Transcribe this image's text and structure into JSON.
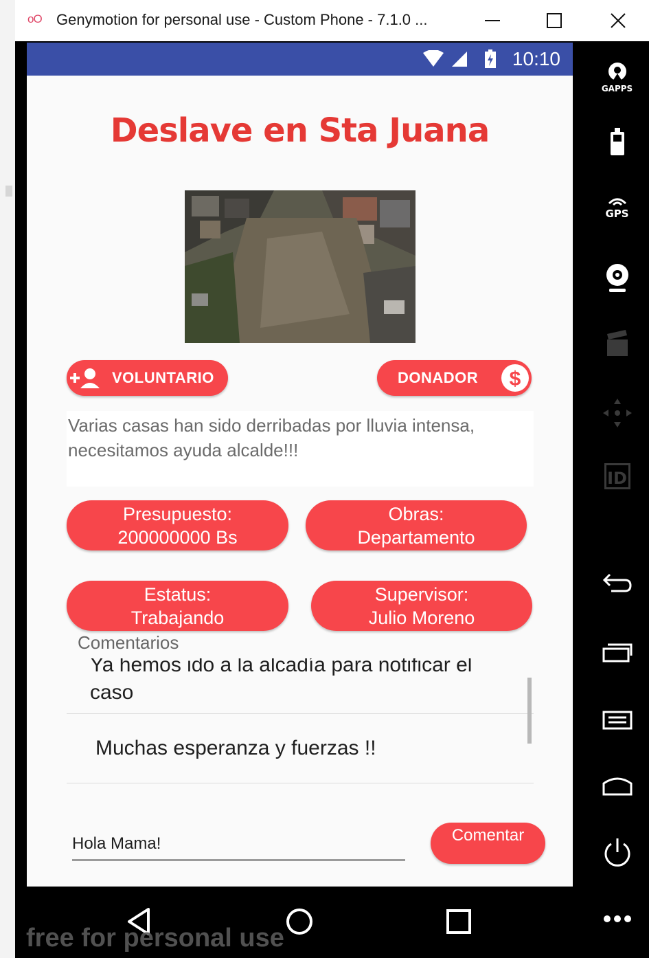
{
  "window": {
    "title": "Genymotion for personal use - Custom Phone - 7.1.0 ...",
    "logo_text": "oO"
  },
  "statusbar": {
    "time": "10:10"
  },
  "screen": {
    "headline": "Deslave en Sta Juana",
    "volunteer_label": "VOLUNTARIO",
    "donor_label": "DONADOR",
    "description": "Varias casas han sido derribadas por lluvia intensa, necesitamos ayuda alcalde!!!",
    "info": {
      "presupuesto": {
        "label": "Presupuesto:",
        "value": "200000000 Bs"
      },
      "obras": {
        "label": "Obras:",
        "value": "Departamento"
      },
      "estatus": {
        "label": "Estatus:",
        "value": "Trabajando"
      },
      "supervisor": {
        "label": "Supervisor:",
        "value": "Julio Moreno"
      }
    },
    "comments_label": "Comentarios",
    "comments": [
      {
        "line1": "Ya hemos ido a la alcadía para notificar el",
        "line2": "caso"
      },
      {
        "text": "Muchas esperanza y fuerzas !!"
      }
    ],
    "comment_input_value": "Hola Mama!",
    "comment_button": "Comentar"
  },
  "sidebar": {
    "gapps": "GAPPS",
    "gps": "GPS",
    "id": "ID"
  },
  "watermark": "free for personal use",
  "colors": {
    "accent": "#f7464b",
    "headline": "#e53935",
    "statusbar": "#3a4fa7"
  },
  "icons": [
    "add-person-icon",
    "dollar-icon",
    "back-nav-icon",
    "home-nav-icon",
    "recents-nav-icon"
  ]
}
